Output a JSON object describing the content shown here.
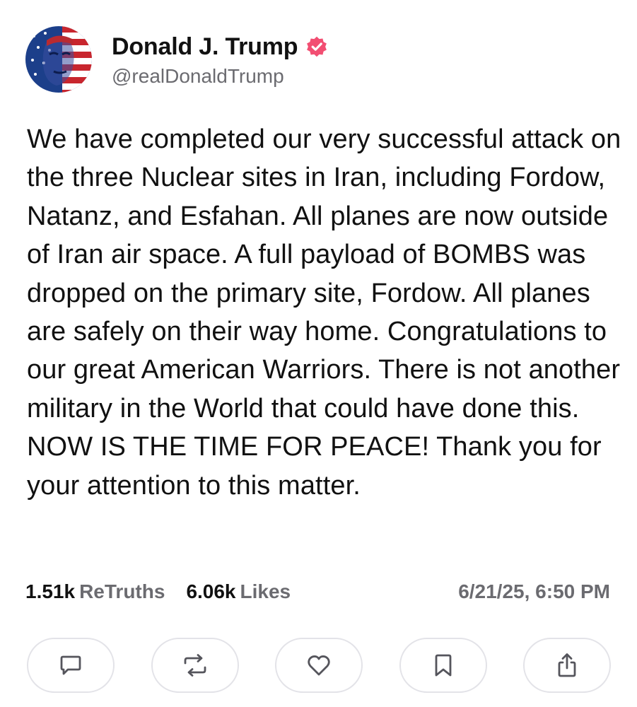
{
  "profile": {
    "display_name": "Donald J. Trump",
    "handle": "@realDonaldTrump",
    "verified_icon": "verified-badge-icon",
    "verified_color": "#f24e72"
  },
  "post": {
    "text": "We have completed our very successful attack on the three Nuclear sites in Iran, including Fordow, Natanz, and Esfahan. All planes are now outside of Iran air space. A full payload of BOMBS was dropped on the primary site, Fordow. All planes are safely on their way home. Congratulations to our great American Warriors. There is not another military in the World that could have done this. NOW IS THE TIME FOR PEACE! Thank you for your attention to this matter."
  },
  "stats": {
    "retruths_count": "1.51k",
    "retruths_label": "ReTruths",
    "likes_count": "6.06k",
    "likes_label": "Likes",
    "timestamp": "6/21/25, 6:50 PM"
  },
  "actions": [
    {
      "icon": "reply-icon"
    },
    {
      "icon": "retruth-icon"
    },
    {
      "icon": "like-heart-icon"
    },
    {
      "icon": "bookmark-icon"
    },
    {
      "icon": "share-icon"
    }
  ],
  "colors": {
    "text": "#111111",
    "muted": "#6b6b70",
    "button_border": "#e3e3e8",
    "icon": "#55555c"
  }
}
